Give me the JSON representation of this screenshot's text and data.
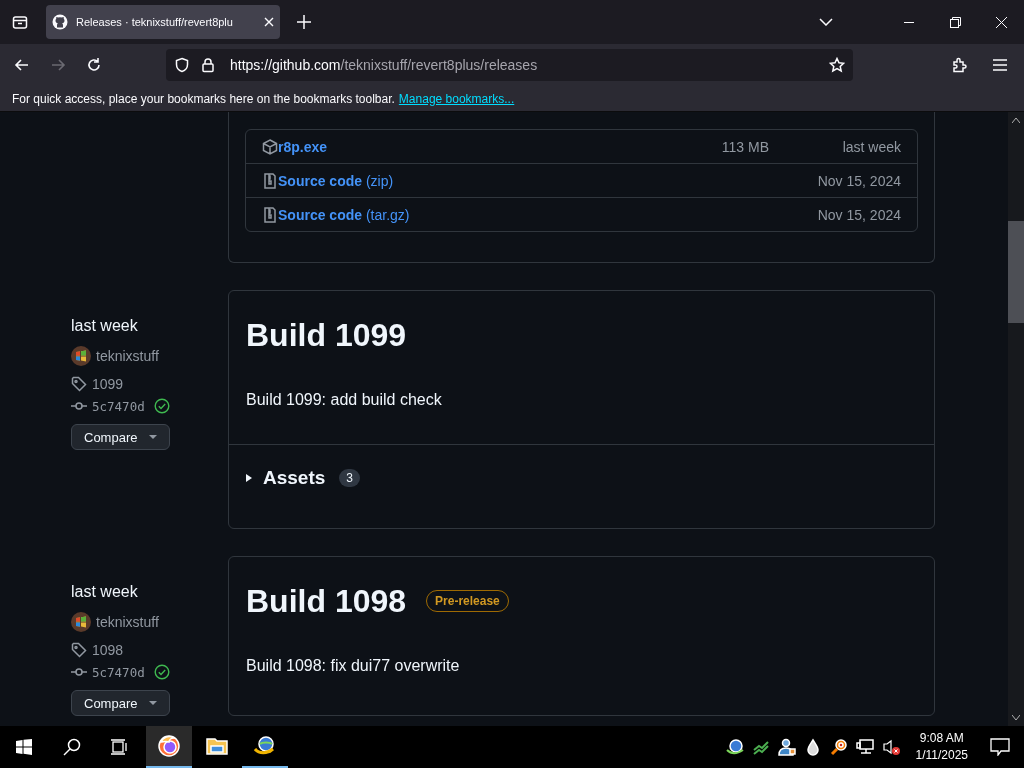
{
  "browser": {
    "tab": {
      "title": "Releases · teknixstuff/revert8plu",
      "selected": true
    },
    "nav_buttons": [
      {
        "kind": "back",
        "disabled": false
      },
      {
        "kind": "forward",
        "disabled": true
      },
      {
        "kind": "reload",
        "disabled": false
      }
    ],
    "url": {
      "host": "https://github.com",
      "path": "/teknixstuff/revert8plus/releases"
    },
    "bookmarks_bar": {
      "message": "For quick access, place your bookmarks here on the bookmarks toolbar.",
      "link": "Manage bookmarks..."
    }
  },
  "previous_release_assets": [
    {
      "kind": "package",
      "name": "r8p.exe",
      "size": "113 MB",
      "date": "last week"
    },
    {
      "kind": "source",
      "name": "Source code",
      "suffix": "(zip)",
      "date": "Nov 15, 2024"
    },
    {
      "kind": "source",
      "name": "Source code",
      "suffix": "(tar.gz)",
      "date": "Nov 15, 2024"
    }
  ],
  "releases": [
    {
      "date": "last week",
      "author": "teknixstuff",
      "tag": "1099",
      "commit": "5c7470d",
      "verified": true,
      "compare": "Compare",
      "title": "Build 1099",
      "body": "Build 1099: add build check",
      "assets": {
        "label": "Assets",
        "count": "3",
        "expanded": false
      }
    },
    {
      "date": "last week",
      "author": "teknixstuff",
      "tag": "1098",
      "commit": "5c7470d",
      "verified": true,
      "compare": "Compare",
      "title": "Build 1098",
      "badge": "Pre-release",
      "body": "Build 1098: fix dui77 overwrite"
    }
  ],
  "taskbar": {
    "apps": [
      {
        "kind": "firefox",
        "focused": true,
        "running": true
      },
      {
        "kind": "explorer",
        "focused": false,
        "running": false
      },
      {
        "kind": "idm",
        "focused": false,
        "running": true
      }
    ],
    "time": "9:08 AM",
    "date": "1/11/2025"
  }
}
